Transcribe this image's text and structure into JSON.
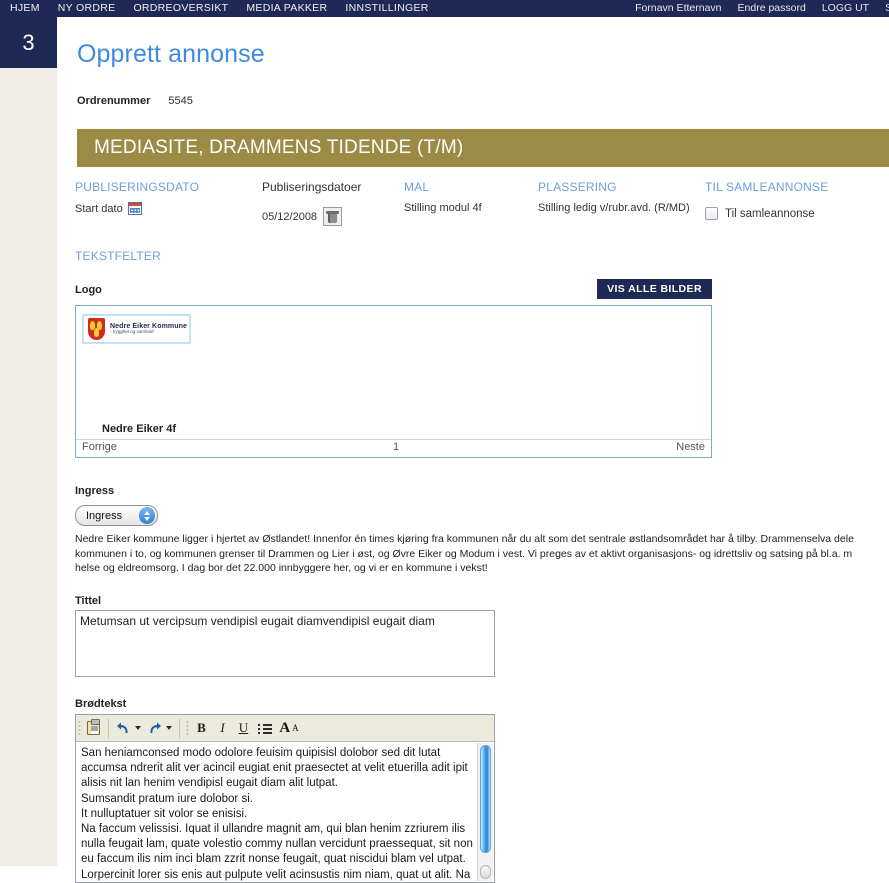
{
  "topnav": {
    "left_items": [
      {
        "label": "HJEM",
        "name": "nav-hjem"
      },
      {
        "label": "NY ORDRE",
        "name": "nav-ny-ordre"
      },
      {
        "label": "ORDREOVERSIKT",
        "name": "nav-ordreoversikt"
      },
      {
        "label": "MEDIA PAKKER",
        "name": "nav-media-pakker"
      },
      {
        "label": "INNSTILLINGER",
        "name": "nav-innstillinger"
      }
    ],
    "user_name": "Fornavn Etternavn",
    "change_password": "Endre passord",
    "logout": "LOGG UT",
    "overflow": "SI",
    "background": "#1e2a55"
  },
  "rail": {
    "step_number": "3",
    "dark_color": "#1e2a55",
    "light_color": "#f0ede7"
  },
  "page": {
    "title": "Opprett annonse",
    "title_color": "#3f8ae0",
    "order_label": "Ordrenummer",
    "order_value": "5545"
  },
  "banner": {
    "text": "MEDIASITE, DRAMMENS TIDENDE (T/M)",
    "color": "#9c8b45"
  },
  "meta": {
    "publiseringsdato": {
      "heading": "PUBLISERINGSDATO",
      "field_label": "Start dato",
      "icon": "calendar-icon"
    },
    "publiseringsdatoer": {
      "heading": "Publiseringsdatoer",
      "date": "05/12/2008",
      "delete_icon": "trash-icon"
    },
    "mal": {
      "heading": "MAL",
      "value": "Stilling modul 4f"
    },
    "plassering": {
      "heading": "PLASSERING",
      "value": "Stilling ledig v/rubr.avd. (R/MD)"
    },
    "samleannonse": {
      "heading": "TIL SAMLEANNONSE",
      "checkbox_label": "Til samleannonse",
      "checked": false
    }
  },
  "tekstfelter": {
    "heading": "TEKSTFELTER",
    "logo": {
      "label": "Logo",
      "show_all_button": "VIS ALLE BILDER",
      "thumb_line1": "Nedre Eiker Kommune",
      "thumb_line2": "- trygghet og samhold",
      "caption": "Nedre Eiker 4f",
      "prev": "Forrige",
      "page": "1",
      "next": "Neste"
    },
    "ingress": {
      "label": "Ingress",
      "select_value": "Ingress",
      "body": "Nedre Eiker kommune ligger i hjertet av Østlandet! Innenfor én times kjøring fra kommunen når du alt som det sentrale østlandsområdet har å tilby. Drammenselva dele\nkommunen i to, og kommunen grenser til Drammen og Lier i øst, og Øvre Eiker og Modum i vest. Vi preges av et aktivt organisasjons- og idrettsliv og satsing på bl.a. m\nhelse og eldreomsorg. I dag bor det 22.000 innbyggere her, og vi er en kommune i vekst!"
    },
    "tittel": {
      "label": "Tittel",
      "value": "Metumsan ut vercipsum vendipisl eugait diamvendipisl eugait diam"
    },
    "brodtekst": {
      "label": "Brødtekst",
      "toolbar": [
        {
          "name": "paste-icon",
          "label": "Lim inn"
        },
        {
          "name": "undo-icon",
          "label": "Angre"
        },
        {
          "name": "redo-icon",
          "label": "Gjør om"
        },
        {
          "name": "bold-icon",
          "label": "B"
        },
        {
          "name": "italic-icon",
          "label": "I"
        },
        {
          "name": "underline-icon",
          "label": "U"
        },
        {
          "name": "bullet-list-icon",
          "label": "Punktliste"
        },
        {
          "name": "font-size-icon",
          "label": "A"
        }
      ],
      "bold_label": "B",
      "italic_label": "I",
      "underline_label": "U",
      "font_big": "A",
      "font_small": "A",
      "body": "San heniamconsed modo odolore feuisim quipisisl dolobor sed dit lutat accumsa ndrerit alit ver acincil eugiat enit praesectet at velit etuerilla adit ipit alisis nit lan henim vendipisl eugait diam alit lutpat.\nSumsandit pratum iure dolobor si.\nIt nulluptatuer sit volor se enisisi.\nNa faccum velissisi. Iquat il ullandre magnit am, qui blan henim zzriurem ilis nulla feugait lam, quate volestio commy nullan vercidunt praessequat, sit non eu faccum ilis nim inci blam zzrit nonse feugait, quat niscidui blam vel utpat.\nLorpercinit lorer sis enis aut pulpute velit acinsustis nim niam, quat ut alit. Na"
    }
  }
}
